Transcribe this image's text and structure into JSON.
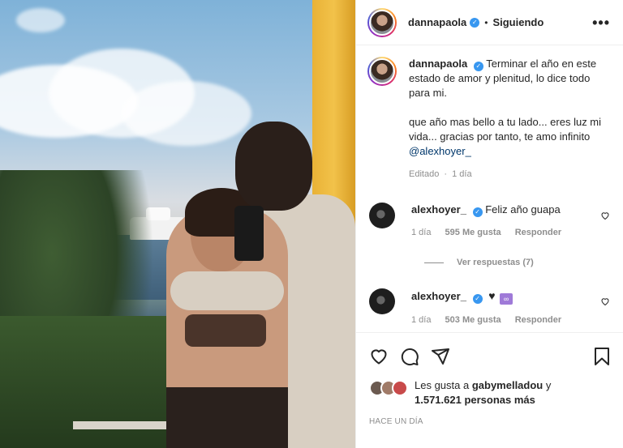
{
  "header": {
    "username": "dannapaola",
    "separator": "•",
    "follow_status": "Siguiendo",
    "more_icon": "more-horizontal-icon"
  },
  "caption": {
    "username": "dannapaola",
    "text_line1": "Terminar el año en este estado de amor y plenitud, lo dice todo para mi.",
    "text_line2": "que año mas bello a tu lado... eres luz mi vida... gracias por tanto, te amo infinito ",
    "mention": "@alexhoyer_",
    "edited": "Editado",
    "time": "1 día"
  },
  "comments": [
    {
      "username": "alexhoyer_",
      "text": "Feliz año guapa",
      "time": "1 día",
      "likes": "595 Me gusta",
      "reply": "Responder"
    },
    {
      "username": "alexhoyer_",
      "text": "",
      "emoji1": "♥",
      "emoji2": "∞",
      "time": "1 día",
      "likes": "503 Me gusta",
      "reply": "Responder"
    }
  ],
  "view_replies": "Ver respuestas (7)",
  "actions": {
    "like_icon": "heart-icon",
    "comment_icon": "comment-icon",
    "share_icon": "send-icon",
    "save_icon": "bookmark-icon"
  },
  "likes": {
    "prefix": "Les gusta a ",
    "user": "gabymelladou",
    "conj": " y",
    "count": "1.571.621 personas más"
  },
  "posted": "HACE UN DÍA",
  "colors": {
    "verified": "#3897f0",
    "link": "#00376b",
    "muted": "#8e8e8e"
  }
}
